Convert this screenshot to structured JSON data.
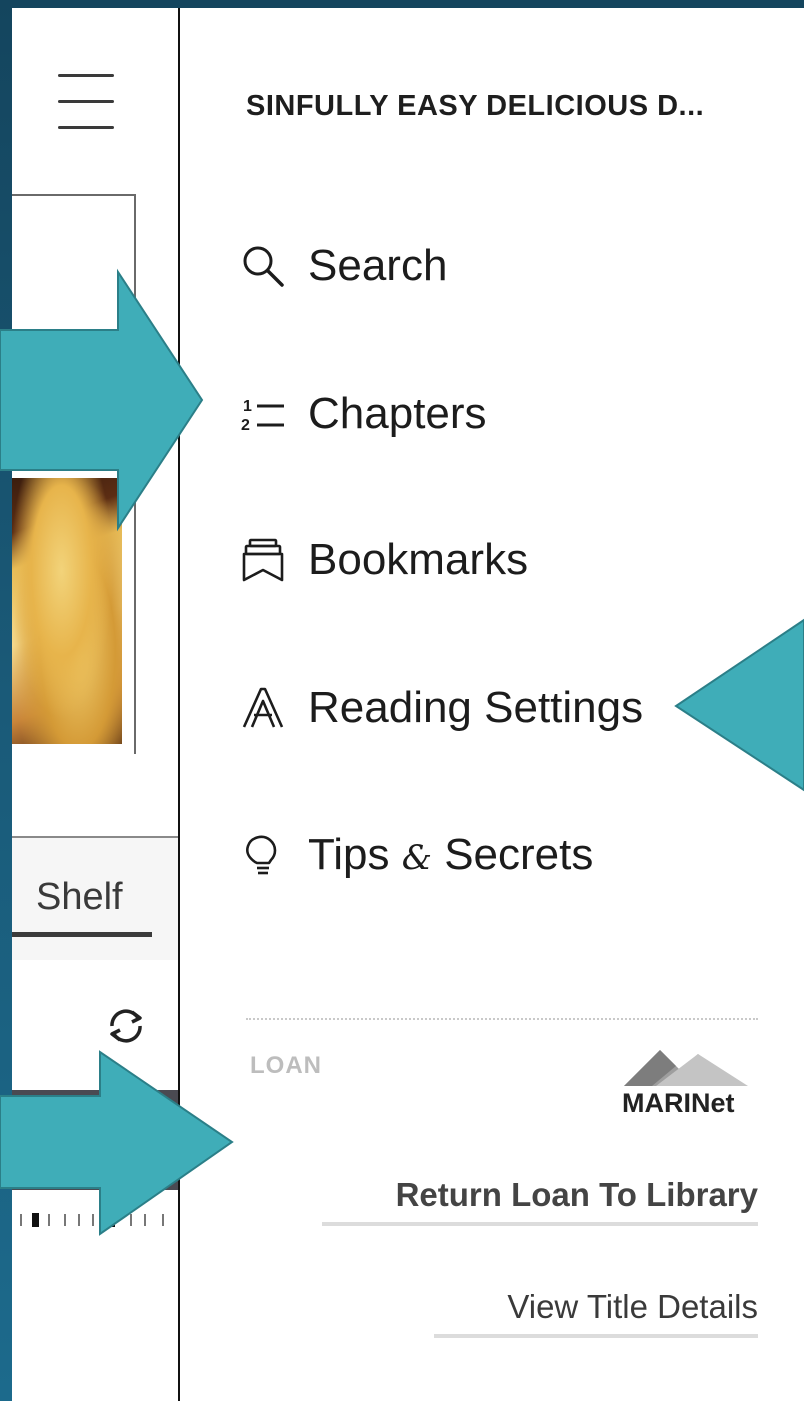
{
  "drawer": {
    "book_title": "SINFULLY EASY DELICIOUS D...",
    "menu": {
      "search": "Search",
      "chapters": "Chapters",
      "bookmarks": "Bookmarks",
      "reading_settings": "Reading Settings",
      "tips_before": "Tips ",
      "tips_amp": "&",
      "tips_after": " Secrets"
    },
    "loan": {
      "label": "LOAN",
      "library_logo_text": "MARINet",
      "return_button": "Return Loan To Library",
      "view_details_button": "View Title Details"
    }
  },
  "background_pane": {
    "shelf_tab": "Shelf"
  },
  "icons": [
    "menu-icon",
    "search-icon",
    "chapters-icon",
    "bookmarks-icon",
    "reading-settings-icon",
    "lightbulb-icon",
    "sync-icon"
  ],
  "colors": {
    "callout_arrow": "#3fadb8",
    "callout_arrow_border": "#2b7f88",
    "frame_background": "#1a5a78"
  }
}
